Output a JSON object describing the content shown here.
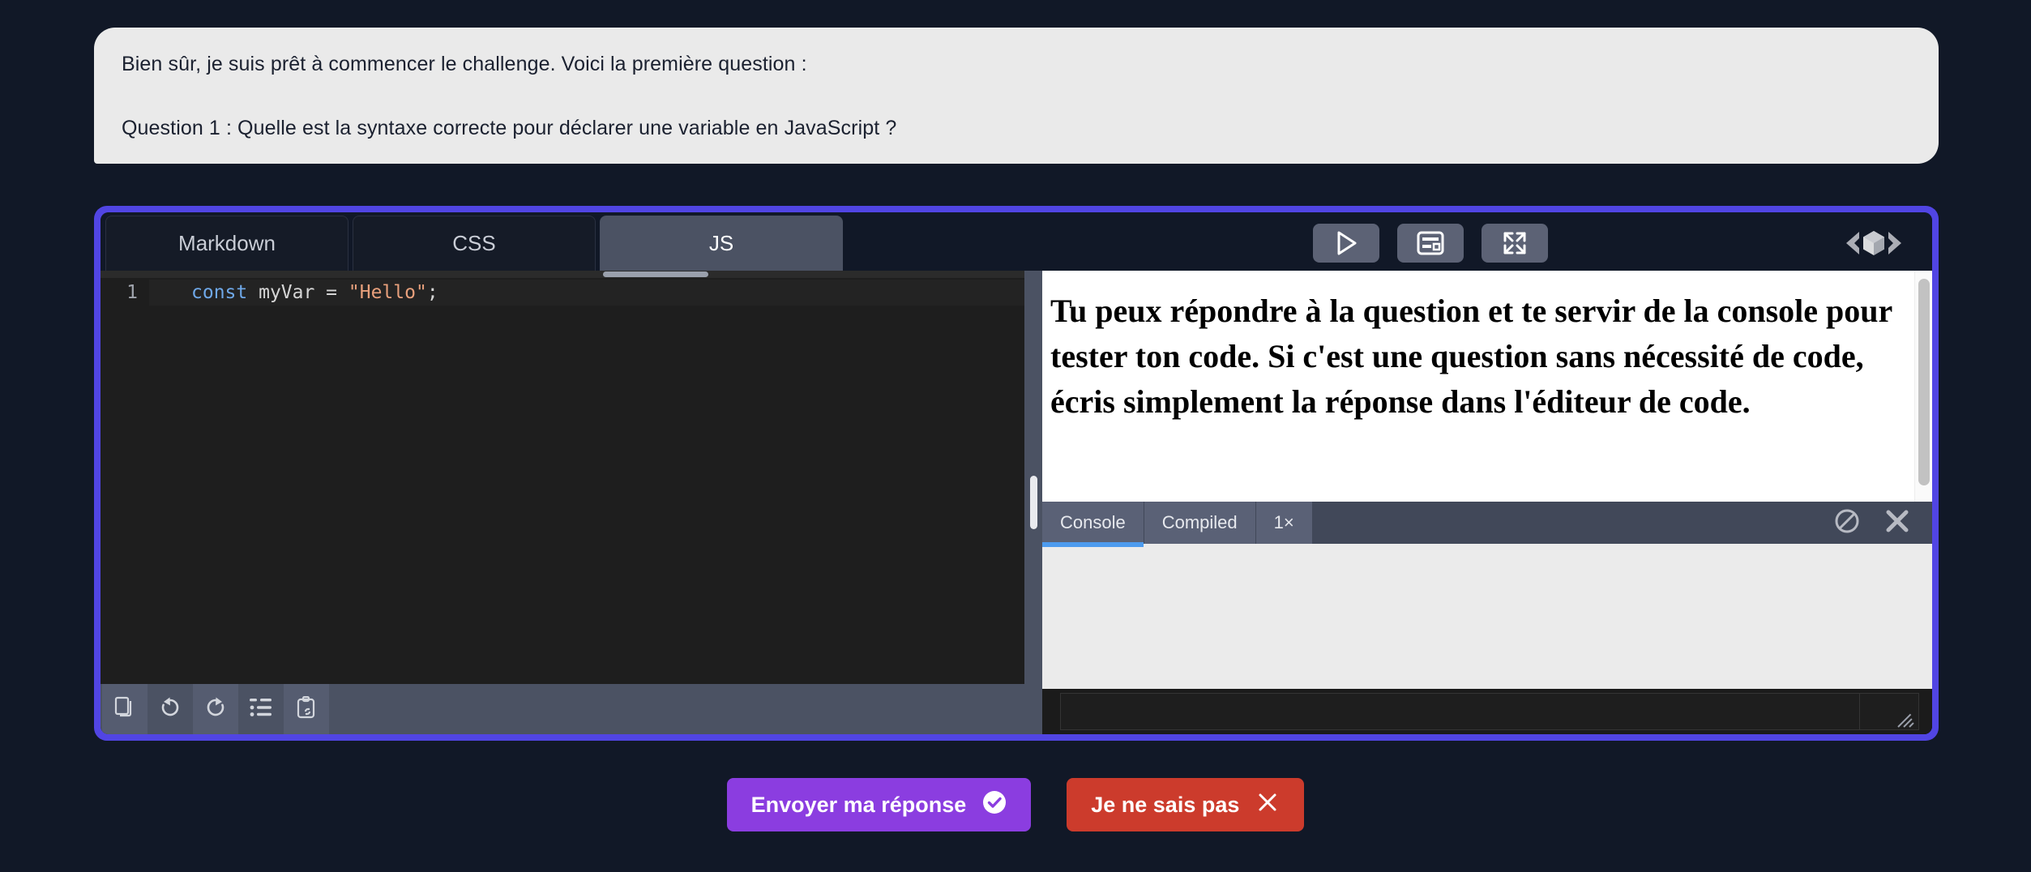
{
  "message": {
    "lines": [
      "Bien sûr, je suis prêt à commencer le challenge. Voici la première question :",
      "Question 1 : Quelle est la syntaxe correcte pour déclarer une variable en JavaScript ?"
    ]
  },
  "sandbox": {
    "file_tabs": [
      {
        "label": "Markdown",
        "active": false
      },
      {
        "label": "CSS",
        "active": false
      },
      {
        "label": "JS",
        "active": true
      }
    ],
    "toolbar": [
      {
        "name": "run-button",
        "icon": "play-icon"
      },
      {
        "name": "layout-button",
        "icon": "layout-icon"
      },
      {
        "name": "fullscreen-button",
        "icon": "expand-icon"
      }
    ],
    "brand": "sandpack-logo",
    "editor": {
      "line_number": "1",
      "code": {
        "keyword": "const",
        "identifier": " myVar = ",
        "string": "\"Hello\"",
        "terminator": ";"
      },
      "bottom_tools": [
        {
          "name": "copy-button",
          "icon": "copy-icon"
        },
        {
          "name": "undo-button",
          "icon": "undo-icon"
        },
        {
          "name": "redo-button",
          "icon": "redo-icon"
        },
        {
          "name": "format-button",
          "icon": "format-icon"
        },
        {
          "name": "share-clipboard-button",
          "icon": "clipboard-link-icon"
        }
      ]
    },
    "preview": {
      "text": "Tu peux répondre à la question et te servir de la console pour tester ton code. Si c'est une question sans nécessité de code, écris simplement la réponse dans l'éditeur de code."
    },
    "console": {
      "tabs": [
        {
          "label": "Console",
          "active": true
        },
        {
          "label": "Compiled",
          "active": false
        },
        {
          "label": "1×",
          "active": false
        }
      ],
      "actions": [
        {
          "name": "clear-console-button",
          "icon": "no-entry-icon"
        },
        {
          "name": "close-console-button",
          "icon": "close-icon"
        }
      ],
      "output": ""
    }
  },
  "actions": {
    "submit": {
      "label": "Envoyer ma réponse",
      "icon": "check-circle-icon",
      "color": "#8B3DE0"
    },
    "dont_know": {
      "label": "Je ne sais pas",
      "icon": "close-icon",
      "color": "#CC3B2C"
    }
  },
  "colors": {
    "page_background": "#111827",
    "bubble_background": "#EAEAEA",
    "frame_accent": "#5145E3",
    "editor_background": "#1E1E1E",
    "console_active_underline": "#4D9BEE"
  }
}
